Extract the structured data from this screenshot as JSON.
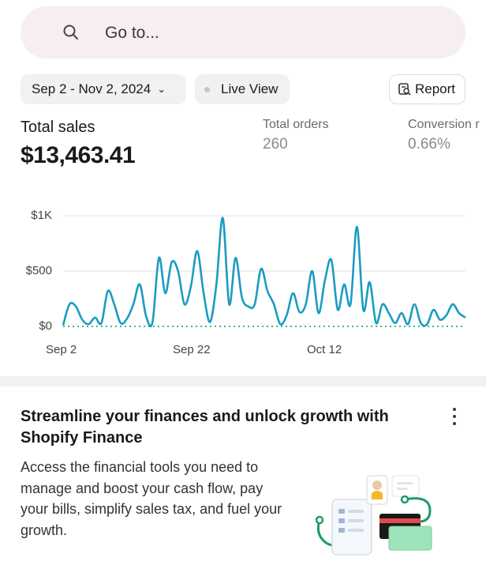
{
  "search": {
    "placeholder": "Go to...",
    "icon": "search-icon"
  },
  "filters": {
    "date_range": "Sep 2 - Nov 2, 2024",
    "live_view": "Live View",
    "report": "Report"
  },
  "metrics": {
    "total_sales_label": "Total sales",
    "total_sales_value": "$13,463.41",
    "total_orders_label": "Total orders",
    "total_orders_value": "260",
    "conversion_label": "Conversion r",
    "conversion_value": "0.66%"
  },
  "chart_data": {
    "type": "line",
    "y_ticks": [
      "$1K",
      "$500",
      "$0"
    ],
    "x_ticks": [
      "Sep 2",
      "Sep 22",
      "Oct 12"
    ],
    "ylim": [
      0,
      1000
    ],
    "x": [
      "Sep 2",
      "Sep 3",
      "Sep 4",
      "Sep 5",
      "Sep 6",
      "Sep 7",
      "Sep 8",
      "Sep 9",
      "Sep 10",
      "Sep 11",
      "Sep 12",
      "Sep 13",
      "Sep 14",
      "Sep 15",
      "Sep 16",
      "Sep 17",
      "Sep 18",
      "Sep 19",
      "Sep 20",
      "Sep 21",
      "Sep 22",
      "Sep 23",
      "Sep 24",
      "Sep 25",
      "Sep 26",
      "Sep 27",
      "Sep 28",
      "Sep 29",
      "Sep 30",
      "Oct 1",
      "Oct 2",
      "Oct 3",
      "Oct 4",
      "Oct 5",
      "Oct 6",
      "Oct 7",
      "Oct 8",
      "Oct 9",
      "Oct 10",
      "Oct 11",
      "Oct 12",
      "Oct 13",
      "Oct 14",
      "Oct 15",
      "Oct 16",
      "Oct 17",
      "Oct 18",
      "Oct 19",
      "Oct 20",
      "Oct 21",
      "Oct 22",
      "Oct 23",
      "Oct 24",
      "Oct 25",
      "Oct 26",
      "Oct 27",
      "Oct 28",
      "Oct 29",
      "Oct 30",
      "Oct 31",
      "Nov 1",
      "Nov 2"
    ],
    "series": [
      {
        "values": [
          10,
          200,
          180,
          60,
          20,
          80,
          30,
          320,
          200,
          30,
          70,
          200,
          380,
          90,
          40,
          620,
          300,
          580,
          500,
          200,
          360,
          680,
          300,
          40,
          380,
          980,
          200,
          620,
          260,
          180,
          200,
          520,
          320,
          200,
          20,
          100,
          300,
          130,
          200,
          500,
          120,
          420,
          600,
          150,
          380,
          200,
          900,
          150,
          400,
          30,
          200,
          120,
          30,
          120,
          20,
          200,
          30,
          20,
          150,
          60,
          100,
          200,
          120,
          80
        ],
        "color": "#1b9cc0"
      },
      {
        "values": [],
        "color": "#3fb58a",
        "note": ""
      }
    ]
  },
  "card": {
    "title": "Streamline your finances and unlock growth with Shopify Finance",
    "body": "Access the financial tools you need to manage and boost your cash flow, pay your bills, simplify sales tax, and fuel your growth."
  },
  "colors": {
    "line": "#1b9cc0",
    "baseline": "#3fb58a",
    "grid": "#e3e3e3"
  }
}
